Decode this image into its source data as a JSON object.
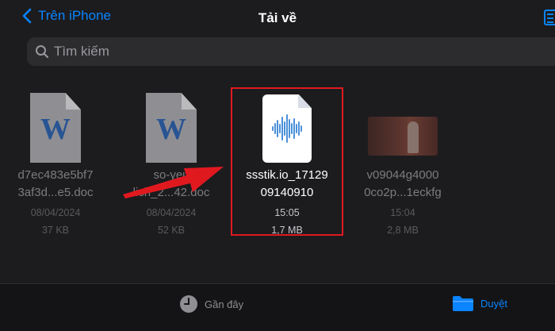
{
  "nav": {
    "back_label": "Trên iPhone",
    "title": "Tải về"
  },
  "search": {
    "placeholder": "Tìm kiếm"
  },
  "files": [
    {
      "name_line1": "d7ec483e5bf7",
      "name_line2": "3af3d...e5.doc",
      "date": "08/04/2024",
      "size": "37 KB",
      "icon": "word-document-icon"
    },
    {
      "name_line1": "so-yeu",
      "name_line2": "lich_2...42.doc",
      "date": "08/04/2024",
      "size": "52 KB",
      "icon": "word-document-icon"
    },
    {
      "name_line1": "ssstik.io_17129",
      "name_line2": "09140910",
      "date": "15:05",
      "size": "1,7 MB",
      "icon": "audio-file-icon"
    },
    {
      "name_line1": "v09044g4000",
      "name_line2": "0co2p...1eckfg",
      "date": "15:04",
      "size": "2,8 MB",
      "icon": "video-thumbnail"
    }
  ],
  "tabs": {
    "recent_label": "Gần đây",
    "browse_label": "Duyệt"
  },
  "colors": {
    "accent": "#0a84ff",
    "highlight": "#e0191f",
    "background": "#1c1c1e"
  }
}
